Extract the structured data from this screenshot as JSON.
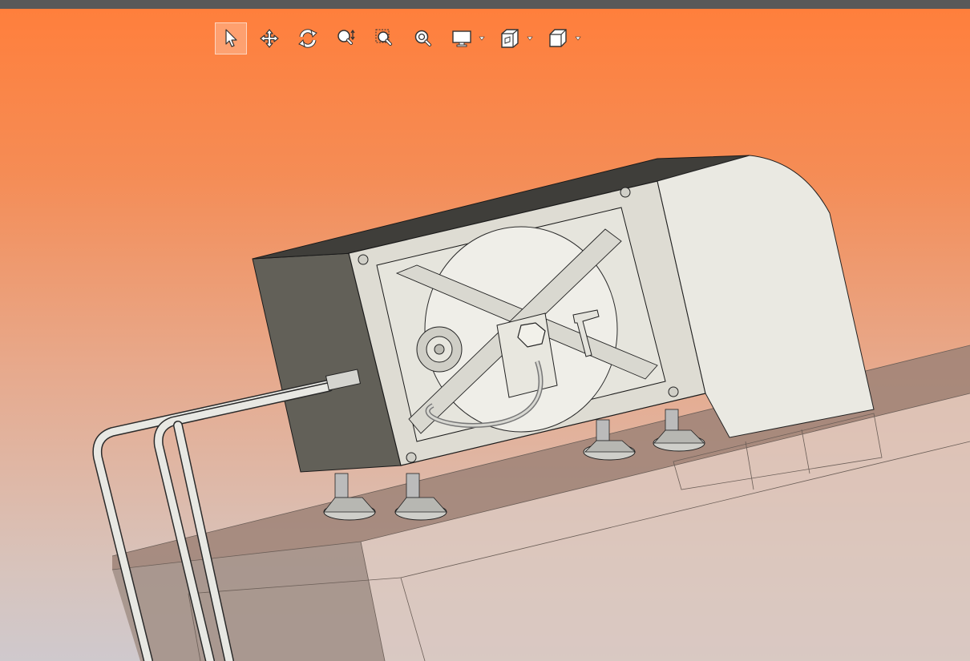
{
  "app": {
    "topbar_color": "#595959"
  },
  "viewport": {
    "background_top": "#ff7f3c",
    "background_bottom": "#cfc9cd"
  },
  "toolbar": {
    "tools": [
      {
        "name": "select",
        "icon": "cursor-arrow-icon",
        "active": true
      },
      {
        "name": "pan",
        "icon": "move-arrows-icon",
        "active": false
      },
      {
        "name": "rotate",
        "icon": "rotate-icon",
        "active": false
      },
      {
        "name": "zoom-interactive",
        "icon": "zoom-interactive-icon",
        "active": false
      },
      {
        "name": "zoom-window",
        "icon": "zoom-window-icon",
        "active": false
      },
      {
        "name": "zoom-fit",
        "icon": "zoom-fit-icon",
        "active": false
      },
      {
        "name": "display-mode",
        "icon": "monitor-icon",
        "has_dropdown": true
      },
      {
        "name": "section",
        "icon": "section-cube-icon",
        "has_dropdown": true
      },
      {
        "name": "view-orientation",
        "icon": "cube-view-icon",
        "has_dropdown": true
      }
    ]
  },
  "model": {
    "housing_color": "#eae9e2",
    "side_panel_color": "#626058",
    "pipe_color": "#e8e8e3",
    "floor_color": "#9e8377"
  }
}
